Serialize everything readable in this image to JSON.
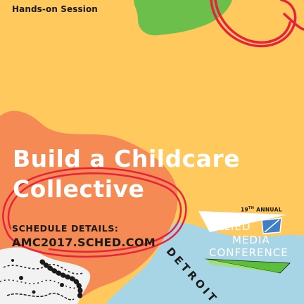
{
  "poster": {
    "session_type": "Hands-on Session",
    "title_line_1": "Build a Childcare",
    "title_line_2": "Collective",
    "schedule_heading": "SCHEDULE DETAILS:",
    "schedule_url": "AMC2017.SCHED.COM"
  },
  "logo": {
    "edition_number": "19",
    "edition_suffix": "TH",
    "edition_word": "ANNUAL",
    "line_1": "ALLIED",
    "line_2": "MEDIA",
    "line_3": "CONFERENCE",
    "city": "DETROIT"
  },
  "colors": {
    "background": "#ffc95e",
    "orange_shape": "#f58a55",
    "light_blue_shape": "#a8d5e6",
    "green_shape": "#6cbf4a",
    "scribble_red": "#e8213c",
    "title_text": "#ffffff",
    "logo_blue": "#3f7fc6",
    "logo_green": "#5bbf3c"
  }
}
